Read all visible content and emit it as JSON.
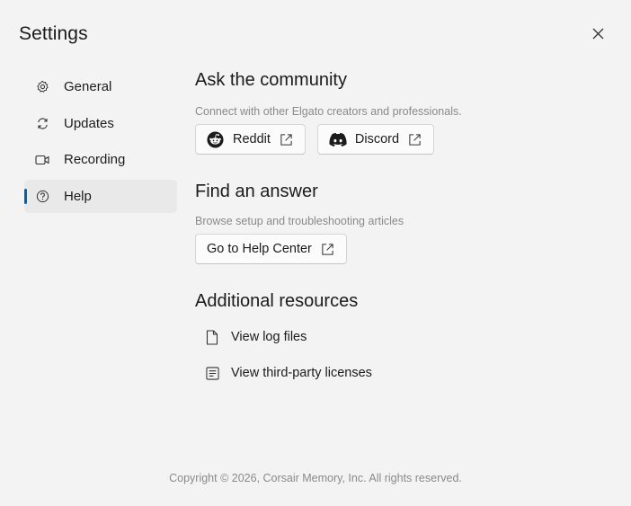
{
  "window": {
    "title": "Settings"
  },
  "sidebar": {
    "items": [
      {
        "label": "General",
        "icon": "gear-icon",
        "active": false
      },
      {
        "label": "Updates",
        "icon": "refresh-icon",
        "active": false
      },
      {
        "label": "Recording",
        "icon": "video-camera-icon",
        "active": false
      },
      {
        "label": "Help",
        "icon": "question-circle-icon",
        "active": true
      }
    ]
  },
  "community": {
    "title": "Ask the community",
    "description": "Connect with other Elgato creators and professionals.",
    "reddit_label": "Reddit",
    "discord_label": "Discord"
  },
  "answer": {
    "title": "Find an answer",
    "description": "Browse setup and troubleshooting articles",
    "help_center_label": "Go to Help Center"
  },
  "resources": {
    "title": "Additional resources",
    "log_files_label": "View log files",
    "licenses_label": "View third-party licenses"
  },
  "footer": {
    "copyright": "Copyright © 2026, Corsair Memory, Inc. All rights reserved."
  },
  "colors": {
    "accent": "#0063b1",
    "background": "#f3f3f3",
    "muted_text": "#8a8a8a"
  }
}
